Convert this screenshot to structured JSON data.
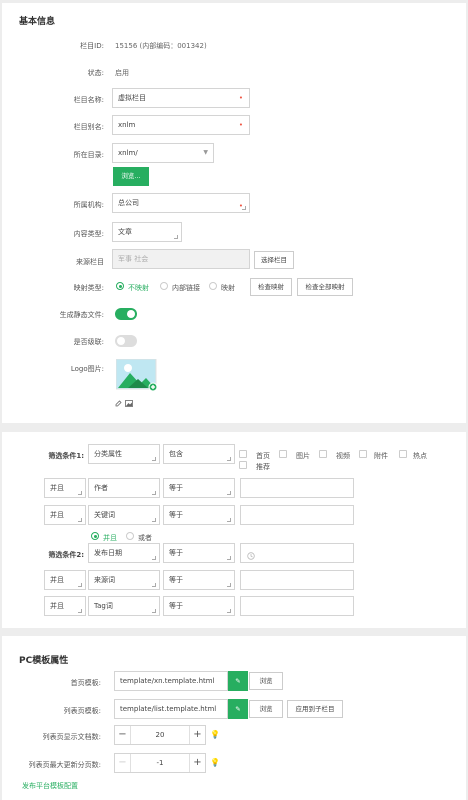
{
  "basic": {
    "title": "基本信息",
    "id_label": "栏目ID:",
    "id_value": "15156 (内部编码：001342)",
    "status_label": "状态:",
    "status_value": "启用",
    "name_label": "栏目名称:",
    "name_value": "虚拟栏目",
    "alias_label": "栏目别名:",
    "alias_value": "xnlm",
    "dir_label": "所在目录:",
    "dir_value": "xnlm/",
    "browse_label": "浏览...",
    "org_label": "所属机构:",
    "org_value": "总公司",
    "type_label": "内容类型:",
    "type_value": "文章",
    "source_label": "来源栏目",
    "source_placeholder": "军事 社会",
    "source_button": "选择栏目",
    "map_label": "映射类型:",
    "map_options": [
      "不映射",
      "内部链接",
      "映射"
    ],
    "map_check": "检查映射",
    "map_check_all": "检查全部映射",
    "static_label": "生成静态文件:",
    "cascade_label": "是否级联:",
    "logo_label": "Logo图片:"
  },
  "filter": {
    "cond1_label": "筛选条件1:",
    "cond1_field": "分类属性",
    "cond1_op": "包含",
    "checkboxes": [
      "首页",
      "图片",
      "视频",
      "附件",
      "热点",
      "推荐"
    ],
    "rows1": [
      {
        "logic": "并且",
        "field": "作者",
        "op": "等于"
      },
      {
        "logic": "并且",
        "field": "关键词",
        "op": "等于"
      }
    ],
    "join_options": [
      "并且",
      "或者"
    ],
    "cond2_label": "筛选条件2:",
    "cond2_field": "发布日期",
    "cond2_op": "等于",
    "rows2": [
      {
        "logic": "并且",
        "field": "来源词",
        "op": "等于"
      },
      {
        "logic": "并且",
        "field": "Tag词",
        "op": "等于"
      }
    ]
  },
  "pc": {
    "title": "PC模板属性",
    "home_label": "首页模板:",
    "home_value": "template/xn.template.html",
    "list_label": "列表页模板:",
    "list_value": "template/list.template.html",
    "browse": "浏览",
    "apply_child": "应用到子栏目",
    "list_count_label": "列表页显示文档数:",
    "list_count_value": "20",
    "max_page_label": "列表页最大更新分页数:",
    "max_page_value": "-1",
    "publish_link": "发布平台模板配置"
  },
  "colors": {
    "accent": "#27ae60",
    "required": "#e54444"
  }
}
